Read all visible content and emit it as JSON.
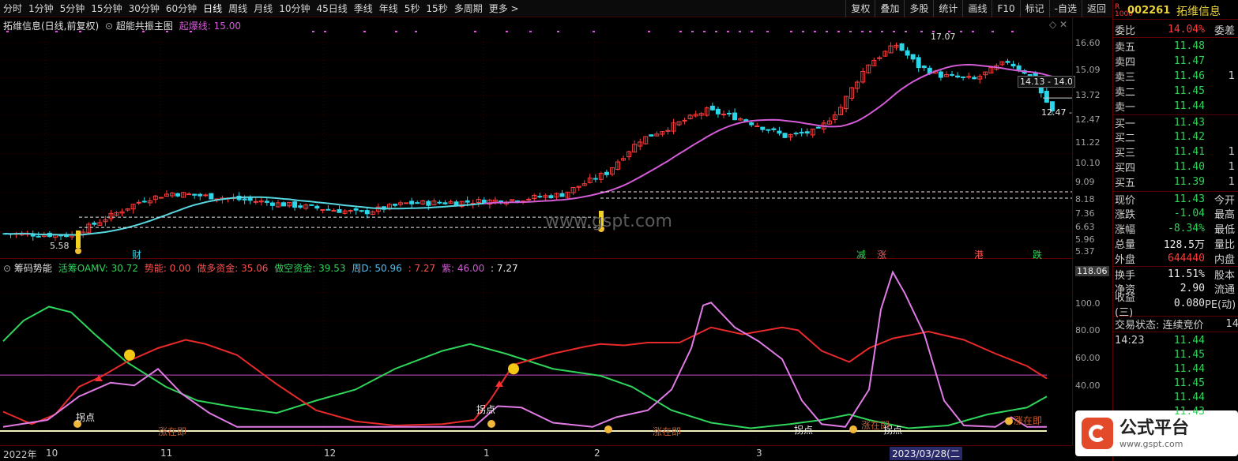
{
  "toolbar": {
    "periods": [
      "分时",
      "1分钟",
      "5分钟",
      "15分钟",
      "30分钟",
      "60分钟",
      "日线",
      "周线",
      "月线",
      "10分钟",
      "45日线",
      "季线",
      "年线",
      "5秒",
      "15秒",
      "多周期",
      "更多 >"
    ],
    "right": [
      "复权",
      "叠加",
      "多股",
      "统计",
      "画线",
      "F10",
      "标记",
      "-自选",
      "返回"
    ]
  },
  "main_chart": {
    "stock": "拓维信息(日线,前复权)",
    "indicator": "超能共振主图",
    "param_label": "起爆线: 15.00",
    "high_mark": "17.07",
    "low_mark": "5.58",
    "label_cai": "财",
    "tags": [
      "减",
      "涨",
      "港",
      "跌"
    ],
    "price_box_1": "14.13 - 14.0",
    "price_box_2": "12.47 -",
    "watermark": "www.gspt.com"
  },
  "price_axis": {
    "ticks": [
      "16.60",
      "15.09",
      "13.72",
      "12.47",
      "11.22",
      "10.10",
      "9.09",
      "8.18",
      "7.36",
      "6.63",
      "5.96",
      "5.37"
    ],
    "ind_ticks": [
      "118.06",
      "100.0",
      "80.00",
      "60.00",
      "40.00"
    ]
  },
  "indicator": {
    "name": "筹码势能",
    "values": [
      {
        "label": "活筹OAMV: 30.72",
        "color": "#2fd45a"
      },
      {
        "label": "势能: 0.00",
        "color": "#ff5050"
      },
      {
        "label": "做多资金: 35.06",
        "color": "#ff5050"
      },
      {
        "label": "做空资金: 39.53",
        "color": "#2fd45a"
      },
      {
        "label": "周D: 50.96",
        "color": "#4fc3f7"
      },
      {
        "label": ": 7.27",
        "color": "#ff5050"
      },
      {
        "label": "紫: 46.00",
        "color": "#d35bd6"
      },
      {
        "label": ": 7.27",
        "color": "#eaeaea"
      }
    ],
    "annotations": {
      "guai": "拐点",
      "zhang": "涨在即"
    }
  },
  "time_axis": {
    "labels": [
      "2022年",
      "10",
      "11",
      "12",
      "1",
      "2",
      "3"
    ],
    "cursor_date": "2023/03/28(二"
  },
  "quote": {
    "code": "002261",
    "name": "拓维信息",
    "weibi_label": "委比",
    "weibi": "14.04%",
    "weicha": "委差",
    "sell": [
      {
        "k": "卖五",
        "p": "11.48"
      },
      {
        "k": "卖四",
        "p": "11.47"
      },
      {
        "k": "卖三",
        "p": "11.46",
        "q": "1"
      },
      {
        "k": "卖二",
        "p": "11.45"
      },
      {
        "k": "卖一",
        "p": "11.44"
      }
    ],
    "buy": [
      {
        "k": "买一",
        "p": "11.43"
      },
      {
        "k": "买二",
        "p": "11.42"
      },
      {
        "k": "买三",
        "p": "11.41",
        "q": "1"
      },
      {
        "k": "买四",
        "p": "11.40",
        "q": "1"
      },
      {
        "k": "买五",
        "p": "11.39",
        "q": "1"
      }
    ],
    "stats": [
      {
        "k": "现价",
        "v": "11.43",
        "e": "今开",
        "c": "grn"
      },
      {
        "k": "涨跌",
        "v": "-1.04",
        "e": "最高",
        "c": "grn"
      },
      {
        "k": "涨幅",
        "v": "-8.34%",
        "e": "最低",
        "c": "grn"
      },
      {
        "k": "总量",
        "v": "128.5万",
        "e": "量比",
        "c": "wht"
      },
      {
        "k": "外盘",
        "v": "644440",
        "e": "内盘",
        "c": "red"
      },
      {
        "k": "换手",
        "v": "11.51%",
        "e": "股本",
        "c": "wht"
      },
      {
        "k": "净资",
        "v": "2.90",
        "e": "流通",
        "c": "wht"
      },
      {
        "k": "收益(三)",
        "v": "0.080",
        "e": "PE(动)",
        "c": "wht"
      }
    ],
    "trade_state": "交易状态: 连续竞价",
    "trade_state_tail": "14",
    "ticks": [
      {
        "t": "14:23",
        "p": "11.44"
      },
      {
        "t": "",
        "p": "11.45"
      },
      {
        "t": "",
        "p": "11.44"
      },
      {
        "t": "",
        "p": "11.45"
      },
      {
        "t": "",
        "p": "11.44"
      },
      {
        "t": "",
        "p": "11.43"
      }
    ]
  },
  "footer_logo": {
    "text": "公式平台",
    "url": "www.gspt.com"
  },
  "colors": {
    "up": "#ff3c3c",
    "down": "#2ad6e8",
    "ma": "#d35bd6",
    "green": "#2fd45a",
    "purple": "#e07be6"
  }
}
